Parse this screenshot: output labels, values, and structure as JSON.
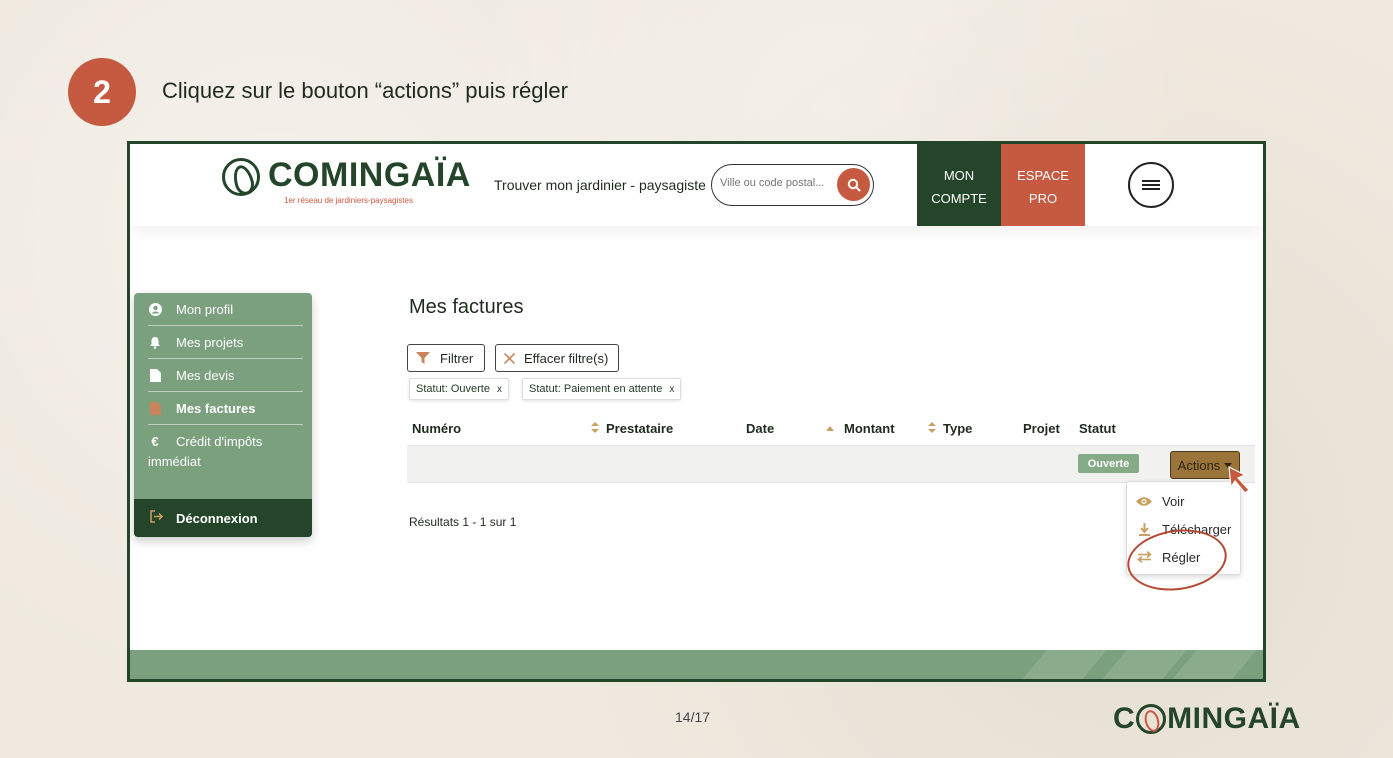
{
  "step": {
    "number": "2",
    "instruction": "Cliquez sur le bouton “actions” puis régler"
  },
  "header": {
    "logo_text": "COMINGAÏA",
    "logo_tagline": "1er réseau de jardiniers-paysagistes",
    "find_label": "Trouver mon jardinier - paysagiste",
    "search_placeholder": "Ville ou code postal...",
    "mon_compte_line1": "MON",
    "mon_compte_line2": "COMPTE",
    "espace_pro_line1": "ESPACE",
    "espace_pro_line2": "PRO"
  },
  "sidebar": {
    "items": [
      {
        "label": "Mon profil",
        "icon": "user-circle-icon"
      },
      {
        "label": "Mes projets",
        "icon": "bell-icon"
      },
      {
        "label": "Mes devis",
        "icon": "file-icon"
      },
      {
        "label": "Mes factures",
        "icon": "file-icon"
      }
    ],
    "credit_symbol": "€",
    "credit_line1": "Crédit d'impôts",
    "credit_line2": "immédiat",
    "logout_label": "Déconnexion",
    "active_icon_color": "#c9845a"
  },
  "main": {
    "title": "Mes factures",
    "filter_label": "Filtrer",
    "clear_filter_label": "Effacer filtre(s)",
    "chips": [
      {
        "label": "Statut: Ouverte",
        "close": "x"
      },
      {
        "label": "Statut: Paiement en attente",
        "close": "x"
      }
    ],
    "columns": {
      "numero": "Numéro",
      "prestataire": "Prestataire",
      "date": "Date",
      "montant": "Montant",
      "type": "Type",
      "projet": "Projet",
      "statut": "Statut"
    },
    "row": {
      "status": "Ouverte",
      "actions_label": "Actions"
    },
    "results": "Résultats 1 - 1 sur 1"
  },
  "dropdown": {
    "items": [
      {
        "label": "Voir",
        "icon": "eye-icon"
      },
      {
        "label": "Télécharger",
        "icon": "download-icon"
      },
      {
        "label": "Régler",
        "icon": "swap-arrows-icon"
      }
    ]
  },
  "footer": {
    "page_number": "14/17",
    "logo_part1": "C",
    "logo_part2": "MINGAÏA"
  },
  "colors": {
    "brand_green": "#24452a",
    "accent_orange": "#c65a40",
    "sage": "#7ba07e",
    "gold": "#c9a062"
  }
}
